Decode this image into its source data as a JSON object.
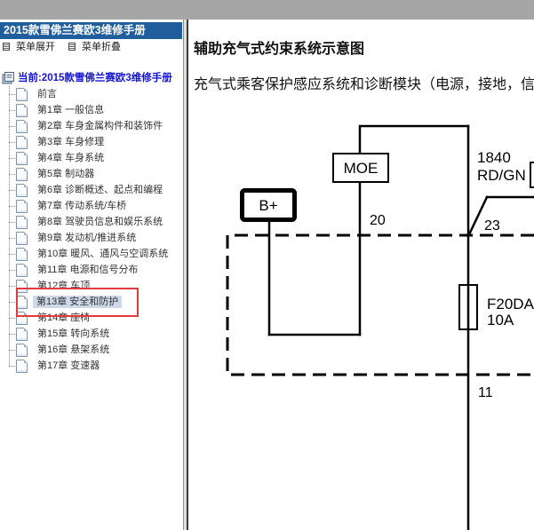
{
  "theme": {
    "top_bar": "#a6a6a6",
    "header_bg": "#1f5d9c",
    "header_text": "#ffffff",
    "root_label": "#1414d6",
    "selection_bg": "#cdd9e8",
    "annotation": "#e23b3b"
  },
  "icons": {
    "menu_expand": "menu-expand-icon",
    "menu_collapse": "menu-collapse-icon",
    "root": "manual-root-icon",
    "page": "page-icon"
  },
  "sidebar": {
    "title": "2015款雪佛兰赛欧3维修手册",
    "menu_expand": "菜单展开",
    "menu_collapse": "菜单折叠",
    "root_label": "当前:2015款雪佛兰赛欧3维修手册",
    "items": [
      {
        "label": "前言"
      },
      {
        "label": "第1章 一般信息"
      },
      {
        "label": "第2章 车身金属构件和装饰件"
      },
      {
        "label": "第3章 车身修理"
      },
      {
        "label": "第4章 车身系统"
      },
      {
        "label": "第5章 制动器"
      },
      {
        "label": "第6章 诊断概述、起点和编程"
      },
      {
        "label": "第7章 传动系统/车桥"
      },
      {
        "label": "第8章 驾驶员信息和娱乐系统"
      },
      {
        "label": "第9章 发动机/推进系统"
      },
      {
        "label": "第10章 暖风、通风与空调系统"
      },
      {
        "label": "第11章 电源和信号分布"
      },
      {
        "label": "第12章 车顶"
      },
      {
        "label": "第13章 安全和防护",
        "selected": true
      },
      {
        "label": "第14章 座椅"
      },
      {
        "label": "第15章 转向系统"
      },
      {
        "label": "第16章 悬架系统"
      },
      {
        "label": "第17章 变速器"
      }
    ]
  },
  "content": {
    "title": "辅助充气式约束系统示意图",
    "intro": "充气式乘客保护感应系统和诊断模块（电源，接地，信",
    "diagram": {
      "moe_label": "MOE",
      "battery_label": "B+",
      "moe_pin": "20",
      "wire_number": "1840",
      "wire_color": "RD/GN",
      "splice_pin": "23",
      "fuse_id": "F20DA",
      "fuse_rating": "10A",
      "lower_pin": "11"
    }
  }
}
